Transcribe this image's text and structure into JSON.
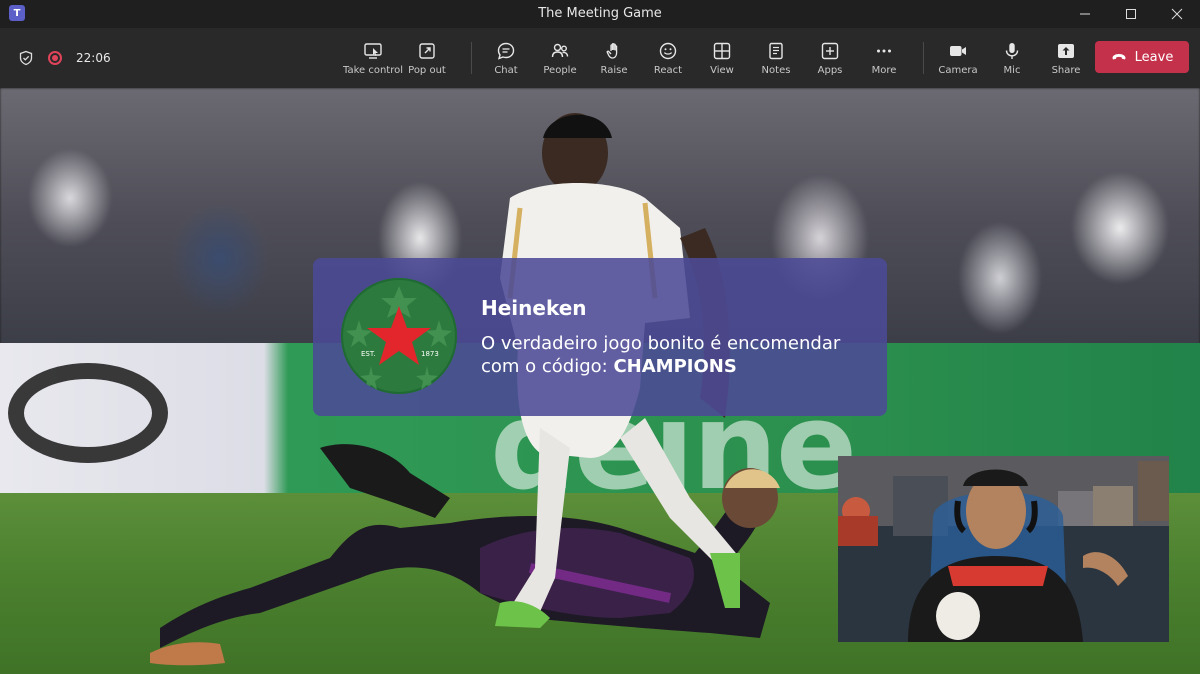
{
  "window": {
    "title": "The Meeting Game"
  },
  "meeting": {
    "timer": "22:06"
  },
  "toolbar": {
    "take_control": "Take control",
    "pop_out": "Pop out",
    "chat": "Chat",
    "people": "People",
    "raise": "Raise",
    "react": "React",
    "view": "View",
    "notes": "Notes",
    "apps": "Apps",
    "more": "More",
    "camera": "Camera",
    "mic": "Mic",
    "share": "Share",
    "leave": "Leave"
  },
  "notification": {
    "sender": "Heineken",
    "message": "O verdadeiro jogo bonito é encomendar com o código: ",
    "code": "CHAMPIONS",
    "logo_left": "EST.",
    "logo_right": "1873"
  },
  "colors": {
    "leave": "#c4314b",
    "card": "#4c4a96",
    "logo_green": "#2c7a3d",
    "star_red": "#e3262b"
  }
}
